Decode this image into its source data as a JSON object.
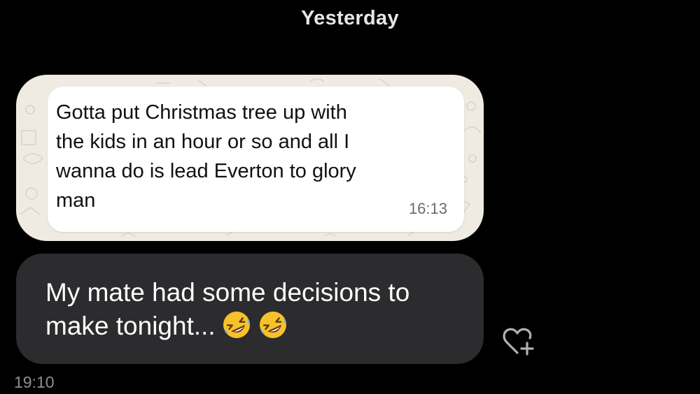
{
  "day_divider": "Yesterday",
  "embedded_screenshot": {
    "message_text": "Gotta put Christmas tree up with\nthe kids in an hour or so and all I\nwanna do is lead Everton to glory\nman",
    "timestamp": "16:13",
    "bubble_color": "#ffffff",
    "wallpaper_color": "#efebe3"
  },
  "message": {
    "text": "My mate had some decisions to make tonight...",
    "emojis": [
      "rolling-on-floor-laughing-emoji",
      "rolling-on-floor-laughing-emoji"
    ],
    "timestamp": "19:10",
    "bubble_color": "#2c2c2e"
  },
  "reaction_button": {
    "icon": "heart-plus-icon"
  }
}
